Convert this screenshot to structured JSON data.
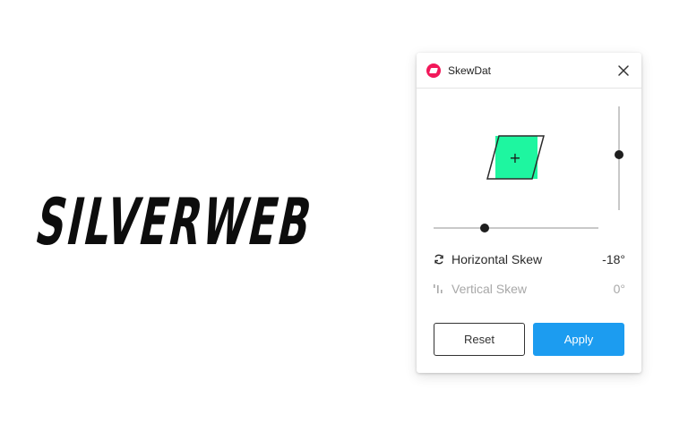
{
  "canvas": {
    "logo_text": "SILVERWEB"
  },
  "plugin": {
    "title": "SkewDat",
    "icon": "skewdat-logo-icon",
    "close_icon": "close-icon",
    "preview": {
      "fill_color": "#1ef6a0",
      "crosshair": "+"
    },
    "sliders": {
      "horizontal_skew_degrees": -18,
      "vertical_skew_degrees": 0
    },
    "rows": {
      "horizontal": {
        "icon": "refresh-icon",
        "label": "Horizontal Skew",
        "value": "-18°"
      },
      "vertical": {
        "icon": "vertical-skew-icon",
        "label": "Vertical Skew",
        "value": "0°"
      }
    },
    "buttons": {
      "reset_label": "Reset",
      "apply_label": "Apply"
    },
    "colors": {
      "accent": "#1c9cf0",
      "brand": "#f2185a",
      "disabled_text": "#a8a8a8"
    }
  }
}
